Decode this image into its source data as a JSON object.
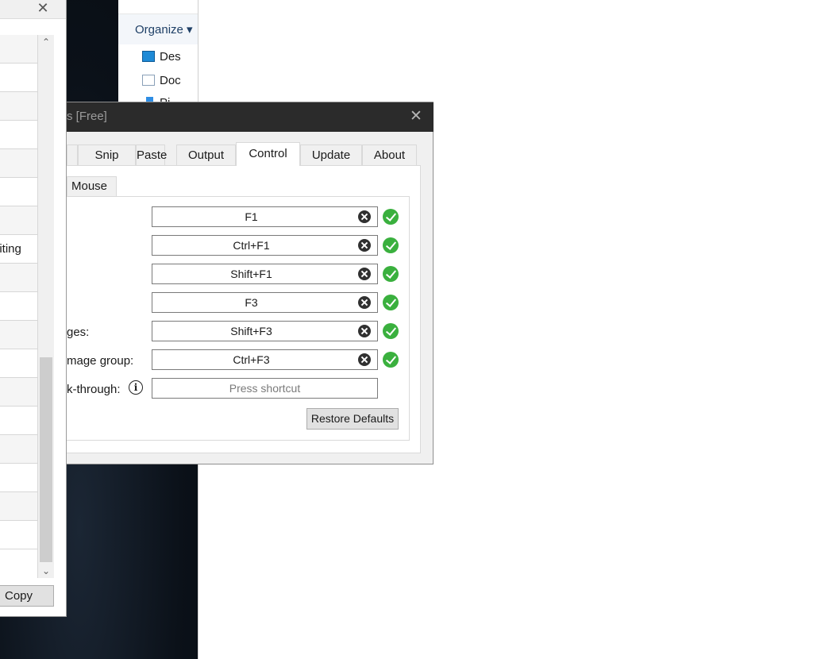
{
  "left_window": {
    "rows": [
      "",
      "",
      "",
      "",
      "",
      "",
      "",
      "diting",
      "",
      "",
      "",
      "",
      "",
      "",
      "",
      "",
      "",
      ""
    ],
    "copy_label": "Copy",
    "close_glyph": "✕",
    "scroll_up_glyph": "⌃",
    "scroll_down_glyph": "⌄"
  },
  "explorer": {
    "organize_label": "Organize ▾",
    "items": [
      {
        "label": "Des",
        "icon": "desktop-icon"
      },
      {
        "label": "Doc",
        "icon": "document-icon"
      },
      {
        "label": "Pi",
        "icon": "pictures-icon"
      }
    ]
  },
  "settings": {
    "title": "s [Free]",
    "close_glyph": "✕",
    "tabs": [
      {
        "label": ""
      },
      {
        "label": "Snip"
      },
      {
        "label": "Paste"
      },
      {
        "label": "Output"
      },
      {
        "label": "Control",
        "active": true
      },
      {
        "label": "Update"
      },
      {
        "label": "About"
      }
    ],
    "subtab": "Mouse",
    "hotkeys": [
      {
        "label": "",
        "value": "F1",
        "status": "ok"
      },
      {
        "label": "",
        "value": "Ctrl+F1",
        "status": "ok"
      },
      {
        "label": "",
        "value": "Shift+F1",
        "status": "ok"
      },
      {
        "label": "",
        "value": "F3",
        "status": "ok"
      },
      {
        "label": "ges:",
        "value": "Shift+F3",
        "status": "ok"
      },
      {
        "label": "mage group:",
        "value": "Ctrl+F3",
        "status": "ok"
      },
      {
        "label": "k-through:",
        "value": "",
        "placeholder": "Press shortcut",
        "status": "none",
        "info_glyph": "i"
      }
    ],
    "restore_label": "Restore Defaults"
  },
  "colors": {
    "titlebar": "#2b2b2b",
    "ok_green": "#3ab03e",
    "desktop": "#0b1119"
  }
}
